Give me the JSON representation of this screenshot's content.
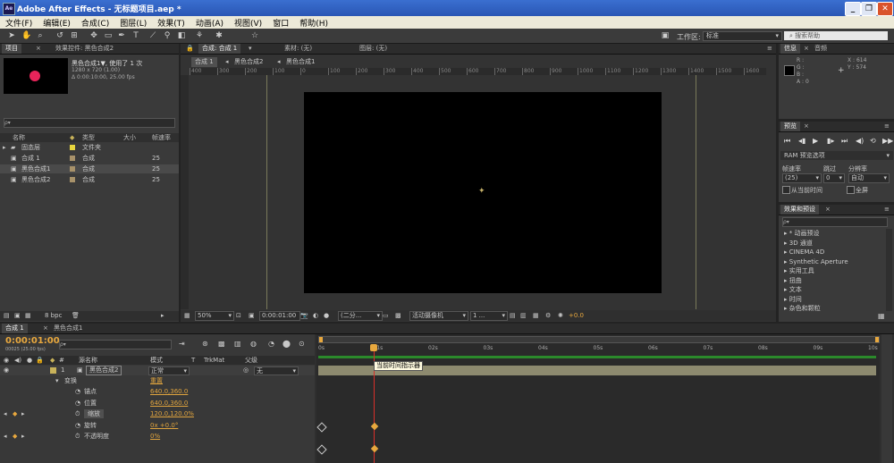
{
  "window": {
    "title": "Adobe After Effects - 无标题项目.aep *",
    "icon": "Ae"
  },
  "menu": [
    "文件(F)",
    "编辑(E)",
    "合成(C)",
    "图层(L)",
    "效果(T)",
    "动画(A)",
    "视图(V)",
    "窗口",
    "帮助(H)"
  ],
  "toolbar": {
    "workspace_label": "工作区:",
    "workspace_value": "标准",
    "search_placeholder": "搜索帮助"
  },
  "project": {
    "tab": "项目",
    "effects_tab": "效果控件: 黑色合成2",
    "item_name": "黑色合成1▼, 使用了 1 次",
    "item_size": "1280 x 720 (1.00)",
    "item_time": "Δ 0:00:10:00, 25.00 fps",
    "search_placeholder": "ρ▾",
    "columns": {
      "name": "名称",
      "type": "类型",
      "size": "大小",
      "fps": "帧速率"
    },
    "items": [
      {
        "name": "固态层",
        "type": "文件夹",
        "fps": ""
      },
      {
        "name": "合成 1",
        "type": "合成",
        "fps": "25"
      },
      {
        "name": "黑色合成1",
        "type": "合成",
        "fps": "25"
      },
      {
        "name": "黑色合成2",
        "type": "合成",
        "fps": "25"
      }
    ],
    "bpc": "8 bpc"
  },
  "viewer": {
    "tab_comp": "合成: 合成 1",
    "tab_footage": "素材: (无)",
    "tab_layer": "图层: (无)",
    "breadcrumbs": [
      "合成 1",
      "黑色合成2",
      "黑色合成1"
    ],
    "ruler_ticks": [
      "400",
      "300",
      "200",
      "100",
      "0",
      "100",
      "200",
      "300",
      "400",
      "500",
      "600",
      "700",
      "800",
      "900",
      "1000",
      "1100",
      "1200",
      "1300",
      "1400",
      "1500",
      "1600"
    ],
    "zoom": "50%",
    "timecode": "0:00:01:00",
    "resolution": "(二分...",
    "camera": "活动摄像机",
    "views": "1 ...",
    "exposure": "+0.0"
  },
  "info": {
    "tab": "信息",
    "audio_tab": "音频",
    "r": "R :",
    "g": "G :",
    "b": "B :",
    "a": "A : 0",
    "x": "X : 614",
    "y": "Y : 574"
  },
  "preview": {
    "tab": "预览",
    "ram_label": "RAM 预览选项",
    "fps_label": "帧速率",
    "skip_label": "跳过",
    "res_label": "分辨率",
    "fps_value": "(25)",
    "skip_value": "0",
    "res_value": "自动",
    "from_current": "从当前时间",
    "fullscreen": "全屏"
  },
  "effects": {
    "tab": "效果和预设",
    "search_placeholder": "ρ▾",
    "items": [
      "* 动画预设",
      "3D 通道",
      "CINEMA 4D",
      "Synthetic Aperture",
      "实用工具",
      "扭曲",
      "文本",
      "时间",
      "杂色和颗粒"
    ]
  },
  "timeline": {
    "tabs": [
      "合成 1",
      "黑色合成1"
    ],
    "timecode": "0:00:01:00",
    "frame_info": "00025 (25.00 fps)",
    "columns": {
      "source": "源名称",
      "mode": "模式",
      "t": "T",
      "trkmat": "TrkMat",
      "parent": "父级"
    },
    "layer": {
      "index": "1",
      "name": "黑色合成2",
      "mode": "正常",
      "parent": "无"
    },
    "transform": {
      "label": "变换",
      "reset": "重置"
    },
    "properties": [
      {
        "name": "锚点",
        "value": "640.0,360.0"
      },
      {
        "name": "位置",
        "value": "640.0,360.0"
      },
      {
        "name": "缩放",
        "value": "120.0,120.0%"
      },
      {
        "name": "旋转",
        "value": "0x +0.0°"
      },
      {
        "name": "不透明度",
        "value": "0%"
      }
    ],
    "time_marks": [
      "0s",
      "01s",
      "02s",
      "03s",
      "04s",
      "05s",
      "06s",
      "07s",
      "08s",
      "09s",
      "10s"
    ],
    "tooltip": "当前时间指示器"
  },
  "colors": {
    "accent": "#e8a83e",
    "layer_bar": "#8d8a6f",
    "work_area": "#2b8a2b",
    "pink_dot": "#e8245a"
  }
}
